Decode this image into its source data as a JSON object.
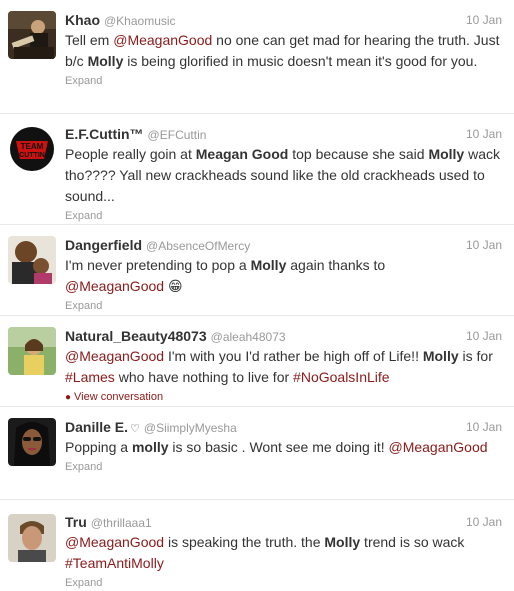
{
  "tweets": [
    {
      "name": "Khao",
      "handle": "@Khaomusic",
      "time": "10 Jan",
      "segments": [
        {
          "t": "Tell em "
        },
        {
          "t": "@MeaganGood",
          "k": "mention"
        },
        {
          "t": " no one can get mad for hearing the truth. Just b/c "
        },
        {
          "t": "Molly",
          "k": "kw"
        },
        {
          "t": " is being glorified in music doesn't mean it's good for you."
        }
      ],
      "action": "Expand",
      "avatar_icon": "musician-photo-avatar"
    },
    {
      "name": "E.F.Cuttin™",
      "handle": "@EFCuttin",
      "time": "10 Jan",
      "segments": [
        {
          "t": "People really goin at "
        },
        {
          "t": "Meagan Good",
          "k": "kw"
        },
        {
          "t": " top because she said "
        },
        {
          "t": "Molly",
          "k": "kw"
        },
        {
          "t": " wack tho???? Yall new crackheads sound like the old crackheads used to sound..."
        }
      ],
      "action": "Expand",
      "avatar_icon": "team-logo-avatar",
      "avatar_text_top": "TEAM",
      "avatar_text_bottom": "CUTTIN"
    },
    {
      "name": "Dangerfield",
      "handle": "@AbsenceOfMercy",
      "time": "10 Jan",
      "segments": [
        {
          "t": "I'm never pretending to pop a "
        },
        {
          "t": "Molly",
          "k": "kw"
        },
        {
          "t": " again thanks to "
        },
        {
          "t": "@MeaganGood",
          "k": "mention"
        },
        {
          "t": " 😁"
        }
      ],
      "action": "Expand",
      "avatar_icon": "man-with-child-photo-avatar"
    },
    {
      "name": "Natural_Beauty48073",
      "handle": "@aleah48073",
      "time": "10 Jan",
      "segments": [
        {
          "t": "@MeaganGood",
          "k": "mention"
        },
        {
          "t": " I'm with you I'd rather be high off of Life!! "
        },
        {
          "t": "Molly",
          "k": "kw"
        },
        {
          "t": " is for "
        },
        {
          "t": "#Lames",
          "k": "tag"
        },
        {
          "t": " who have nothing to live for "
        },
        {
          "t": "#NoGoalsInLife",
          "k": "tag"
        }
      ],
      "action": "View conversation",
      "action_icon": "speech-bubble-icon",
      "avatar_icon": "woman-outdoors-photo-avatar"
    },
    {
      "name": "Danille E.",
      "name_icon": "♡",
      "handle": "@SiimplyMyesha",
      "time": "10 Jan",
      "segments": [
        {
          "t": "Popping a "
        },
        {
          "t": "molly",
          "k": "kw"
        },
        {
          "t": " is so basic . Wont see me doing it! "
        },
        {
          "t": "@MeaganGood",
          "k": "mention"
        }
      ],
      "action": "Expand",
      "avatar_icon": "woman-selfie-photo-avatar"
    },
    {
      "name": "Tru",
      "handle": "@thrillaaa1",
      "time": "10 Jan",
      "segments": [
        {
          "t": "@MeaganGood",
          "k": "mention"
        },
        {
          "t": " is speaking the truth. the "
        },
        {
          "t": "Molly",
          "k": "kw"
        },
        {
          "t": " trend is so wack "
        },
        {
          "t": "#TeamAntiMolly",
          "k": "tag"
        }
      ],
      "action": "Expand",
      "avatar_icon": "young-man-photo-avatar"
    }
  ]
}
